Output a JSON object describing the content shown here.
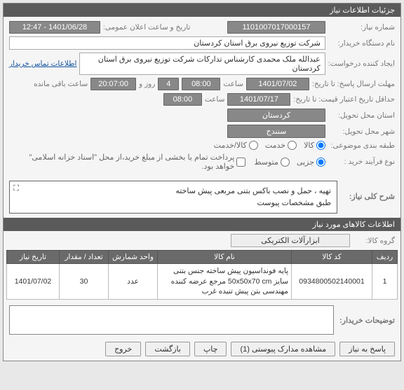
{
  "panel_title": "جزئیات اطلاعات نیاز",
  "fields": {
    "need_no_label": "شماره نیاز:",
    "need_no": "1101007017000157",
    "datetime_label": "تاریخ و ساعت اعلان عمومی:",
    "datetime": "1401/06/28 - 12:47",
    "buyer_name_label": "نام دستگاه خریدار:",
    "buyer_name": "شرکت توزیع نیروی برق استان کردستان",
    "requester_label": "ایجاد کننده درخواست:",
    "requester": "عبدالله ملک محمدی کارشناس تدارکات شرکت توزیع نیروی برق استان کردستان",
    "contact_link": "اطلاعات تماس خریدار",
    "deadline_label": "مهلت ارسال پاسخ: تا تاریخ:",
    "deadline_date": "1401/07/02",
    "deadline_hour_l": "ساعت",
    "deadline_hour": "08:00",
    "day_l": "روز و",
    "day_v": "4",
    "remain_l": "ساعت باقی مانده",
    "remain_v": "20:07:00",
    "validity_label": "حداقل تاریخ اعتبار قیمت: تا تاریخ:",
    "validity_date": "1401/07/17",
    "validity_hour_l": "ساعت",
    "validity_hour": "08:00",
    "province_label": "استان محل تحویل:",
    "province": "کردستان",
    "city_label": "شهر محل تحویل:",
    "city": "سنندج",
    "subject_label": "طبقه بندی موضوعی:",
    "subject_opts": {
      "goods": "کالا",
      "service": "خدمت",
      "both": "کالا/خدمت"
    },
    "process_label": "نوع فرآیند خرید :",
    "process_opts": {
      "minor": "جزیی",
      "medium": "متوسط"
    },
    "process_note": "پرداخت تمام یا بخشی از مبلغ خرید،از محل \"اسناد خزانه اسلامی\" خواهد بود.",
    "need_title_label": "شرح کلی نیاز:",
    "need_title_line1": "تهیه ، حمل و نصب باکس بتنی مربعی پیش ساخته",
    "need_title_line2": "طبق مشخصات پیوست"
  },
  "items_header": "اطلاعات کالاهای مورد نیاز",
  "group_label": "گروه کالا:",
  "group_value": "ابزارآلات الکتریکی",
  "cols": {
    "row": "ردیف",
    "code": "کد کالا",
    "name": "نام کالا",
    "unit": "واحد شمارش",
    "qty": "تعداد / مقدار",
    "date": "تاریخ نیاز"
  },
  "rows": [
    {
      "row": "1",
      "code": "0934800502140001",
      "name": "پایه فونداسیون پیش ساخته جنس بتنی سایز 50x50x70 cm مرجع عرضه کننده مهندسی بتن پیش تنیده غرب",
      "unit": "عدد",
      "qty": "30",
      "date": "1401/07/02"
    }
  ],
  "buyer_note_label": "توضیحات خریدار:",
  "buttons": {
    "reply": "پاسخ به نیاز",
    "attach": "مشاهده مدارک پیوستی (1)",
    "print": "چاپ",
    "back": "بازگشت",
    "exit": "خروج"
  }
}
